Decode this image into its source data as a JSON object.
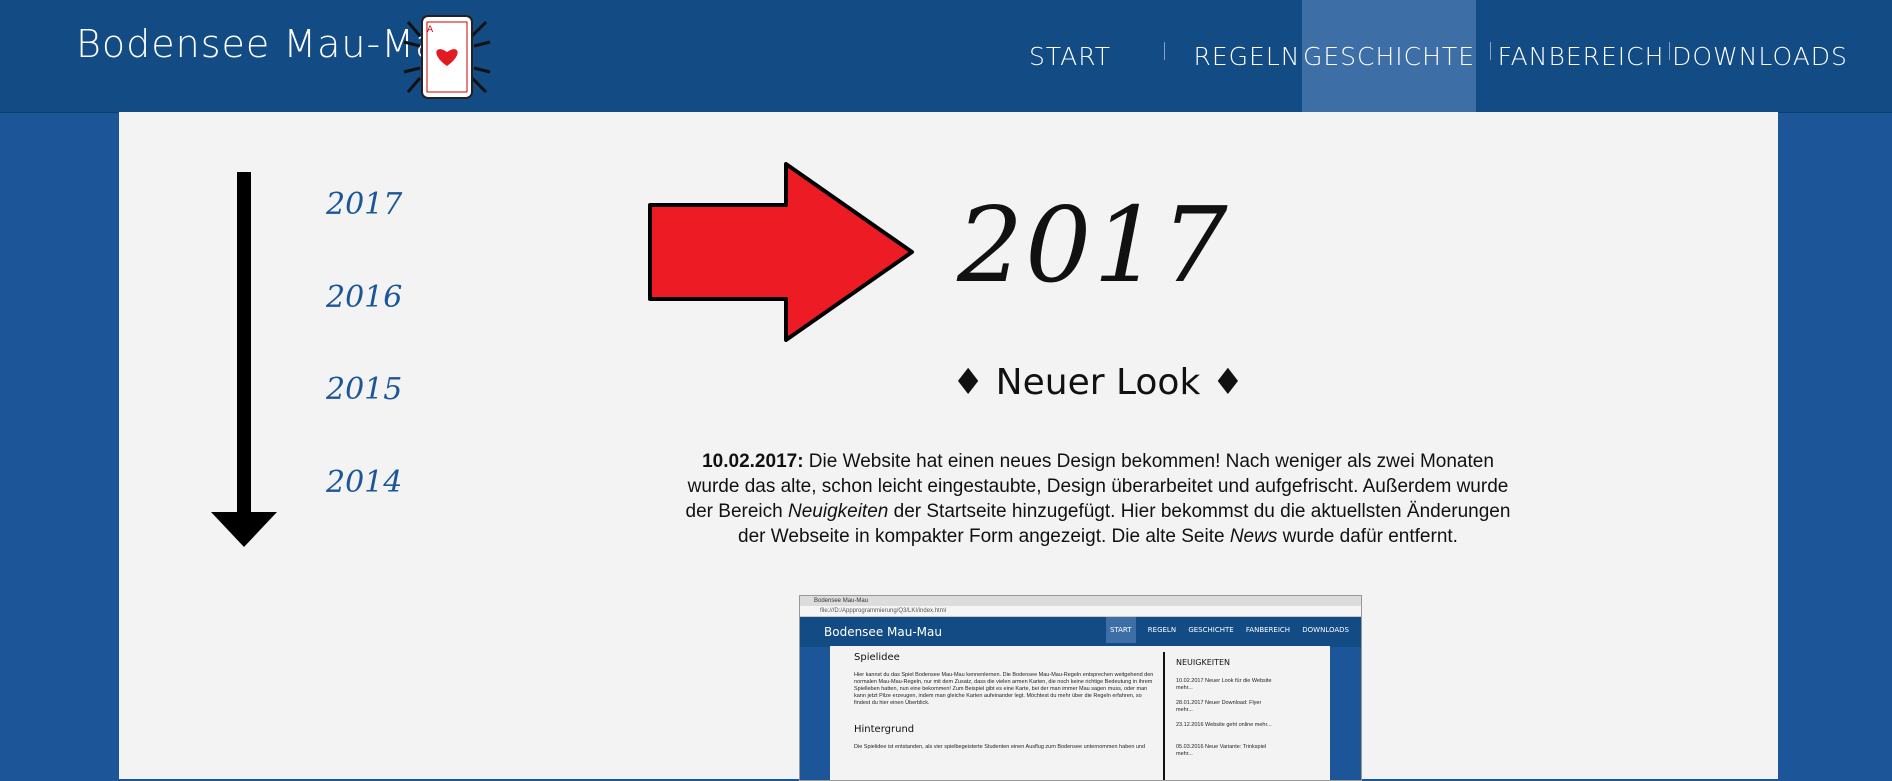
{
  "header": {
    "brand": "Bodensee Mau-Mau",
    "nav": [
      {
        "label": "START"
      },
      {
        "label": "REGELN"
      },
      {
        "label": "GESCHICHTE"
      },
      {
        "label": "FANBEREICH"
      },
      {
        "label": "DOWNLOADS"
      }
    ]
  },
  "timeline": {
    "years": [
      "2017",
      "2016",
      "2015",
      "2014"
    ]
  },
  "main": {
    "year": "2017",
    "subtitle": "♦ Neuer Look ♦",
    "date": "10.02.2017:",
    "text1": " Die Website hat einen neues Design bekommen! Nach weniger als zwei Monaten wurde das alte, schon leicht eingestaubte, Design überarbeitet und aufgefrischt. Außerdem wurde der Bereich ",
    "em1": "Neuigkeiten",
    "text2": " der Startseite hinzugefügt. Hier bekommst du die aktuellsten Änderungen der Webseite in kompakter Form angezeigt. Die alte Seite ",
    "em2": "News",
    "text3": " wurde dafür entfernt."
  },
  "screenshot": {
    "tab": "Bodensee Mau-Mau",
    "url": "file:///D:/Appprogrammierung/Q3/LKI/index.html",
    "brand": "Bodensee Mau-Mau",
    "nav": [
      "START",
      "REGELN",
      "GESCHICHTE",
      "FANBEREICH",
      "DOWNLOADS"
    ],
    "h1": "Spielidee",
    "p1": "Hier kannst du das Spiel Bodensee Mau-Mau kennenlernen. Die Bodensee Mau-Mau-Regeln entsprechen weitgehend den normalen Mau-Mau-Regeln, nur mit dem Zusatz, dass die vielen armen Karten, die noch keine richtige Bedeutung in ihrem Spielleben hatten, nun eine bekommen! Zum Beispiel gibt es eine Karte, bei der man immer Mau sagen muss, oder man kann jetzt Pilze erzeugen, indem man gleiche Karten aufeinander legt. Möchtest du mehr über die Regeln erfahren, so findest du hier einen Überblick.",
    "h2": "Hintergrund",
    "p2": "Die Spielidee ist entstanden, als vier spielbegeisterte Studenten einen Ausflug zum Bodensee unternommen haben und",
    "news_title": "NEUIGKEITEN",
    "news": [
      "10.02.2017 Neuer Look für die Website mehr...",
      "28.01.2017 Neuer Download: Flyer mehr...",
      "23.12.2016 Website geht online mehr...",
      "05.03.2016 Neue Variante: Trinkspiel mehr..."
    ]
  },
  "colors": {
    "header_bg": "#134b85",
    "page_bg": "#1c5699",
    "content_bg": "#f3f3f3",
    "active_nav": "#3d6fa6",
    "arrow_red": "#ed1c24"
  }
}
